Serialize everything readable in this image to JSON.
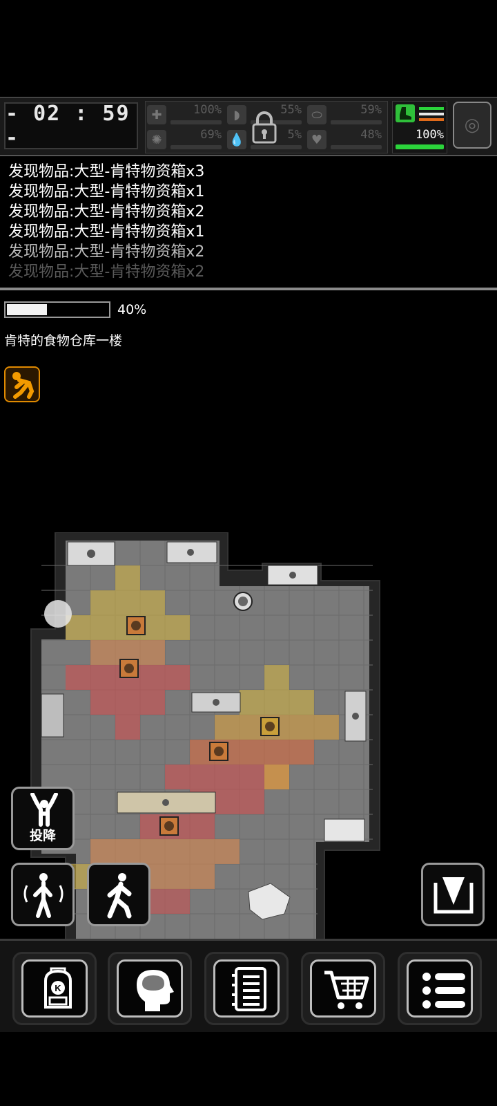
{
  "hud": {
    "timer": "- 02 : 59 -",
    "stats": [
      {
        "name": "health",
        "icon": "medkit-icon",
        "value": "100%"
      },
      {
        "name": "food",
        "icon": "stomach-icon",
        "value": "55%"
      },
      {
        "name": "drink",
        "icon": "pill-icon",
        "value": "59%"
      },
      {
        "name": "mind",
        "icon": "brain-icon",
        "value": "69%"
      },
      {
        "name": "water",
        "icon": "droplet-icon",
        "value": "5%"
      },
      {
        "name": "mood",
        "icon": "heart-icon",
        "value": "48%"
      }
    ],
    "stamina": {
      "value": "100%",
      "level": 1.0
    },
    "colors": {
      "stamina_green": "#2bd43b",
      "stamina_orange": "#e06a1a"
    }
  },
  "log": [
    "发现物品:大型-肯特物资箱x3",
    "发现物品:大型-肯特物资箱x1",
    "发现物品:大型-肯特物资箱x2",
    "发现物品:大型-肯特物资箱x1",
    "发现物品:大型-肯特物资箱x2",
    "发现物品:大型-肯特物资箱x2"
  ],
  "progress": {
    "text": "40%",
    "value": 0.4
  },
  "location": "肯特的食物仓库一楼",
  "status_icon": "tired-person-icon",
  "actions": {
    "surrender": "投降"
  },
  "nav": [
    "backpack-icon",
    "brain-skills-icon",
    "journal-icon",
    "shop-cart-icon",
    "menu-list-icon"
  ]
}
